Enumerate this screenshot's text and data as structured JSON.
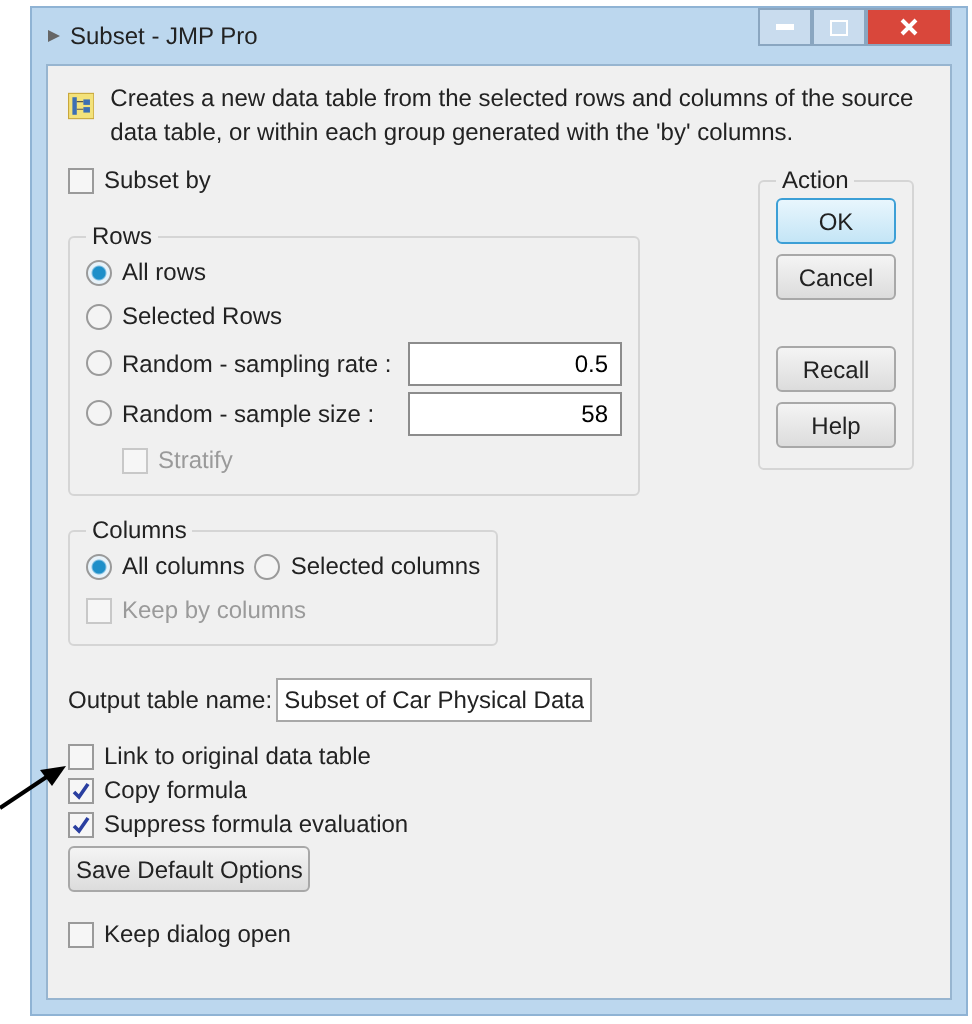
{
  "window": {
    "title": "Subset - JMP Pro"
  },
  "description": "Creates a new data table from the selected rows and columns of the source data table, or within each group generated with the 'by' columns.",
  "subset_by": {
    "label": "Subset by",
    "checked": false
  },
  "rows": {
    "title": "Rows",
    "options": [
      {
        "label": "All rows",
        "selected": true,
        "kind": "plain"
      },
      {
        "label": "Selected Rows",
        "selected": false,
        "kind": "plain"
      },
      {
        "label": "Random - sampling rate :",
        "selected": false,
        "kind": "field",
        "value": "0.5"
      },
      {
        "label": "Random - sample size :",
        "selected": false,
        "kind": "field",
        "value": "58"
      }
    ],
    "stratify": {
      "label": "Stratify",
      "checked": false,
      "disabled": true
    }
  },
  "columns": {
    "title": "Columns",
    "options": [
      {
        "label": "All columns",
        "selected": true
      },
      {
        "label": "Selected columns",
        "selected": false
      }
    ],
    "keep_by_columns": {
      "label": "Keep by columns",
      "checked": false,
      "disabled": true
    }
  },
  "action": {
    "title": "Action",
    "buttons": [
      {
        "label": "OK",
        "kind": "default"
      },
      {
        "label": "Cancel",
        "kind": "normal"
      },
      {
        "label": "Recall",
        "kind": "spaced"
      },
      {
        "label": "Help",
        "kind": "normal"
      }
    ]
  },
  "output_table": {
    "label": "Output table name:",
    "value": "Subset of Car Physical Data"
  },
  "options": [
    {
      "label": "Link to original data table",
      "checked": false
    },
    {
      "label": "Copy formula",
      "checked": true
    },
    {
      "label": "Suppress formula evaluation",
      "checked": true
    }
  ],
  "save_button": "Save Default Options",
  "keep_open": {
    "label": "Keep dialog open",
    "checked": false
  }
}
